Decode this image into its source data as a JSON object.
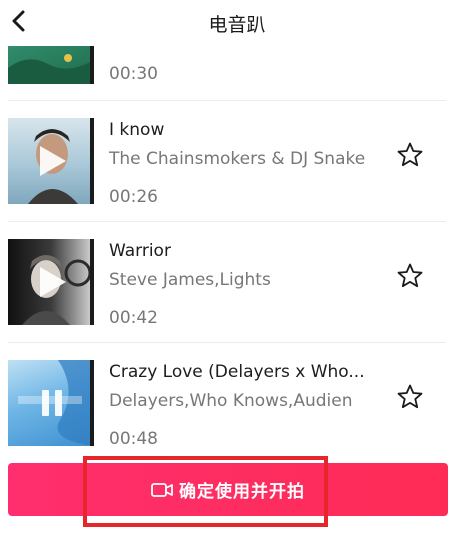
{
  "header": {
    "title": "电音趴"
  },
  "tracks": [
    {
      "title": "",
      "artist": "",
      "duration": "00:30",
      "cover_colors": [
        "#1f6b4a",
        "#2f8a6a",
        "#86c3a4"
      ]
    },
    {
      "title": "I know",
      "artist": "The Chainsmokers & DJ Snake",
      "duration": "00:26",
      "cover_colors": [
        "#9fc4d6",
        "#c7d9e2",
        "#3c3a38"
      ]
    },
    {
      "title": "Warrior",
      "artist": "Steve James,Lights",
      "duration": "00:42",
      "cover_colors": [
        "#2a2a2a",
        "#9a9a9a",
        "#e9e9e9"
      ]
    },
    {
      "title": "Crazy Love (Delayers x Who...",
      "artist": "Delayers,Who Knows,Audien",
      "duration": "00:48",
      "cover_colors": [
        "#3d8fd0",
        "#6fb6e6",
        "#bfe0f4"
      ]
    }
  ],
  "action": {
    "confirm_label": "确定使用并开拍",
    "icon": "video-camera-icon",
    "accent": "#fe2c55"
  },
  "annotation": {
    "color": "#e6262b"
  }
}
